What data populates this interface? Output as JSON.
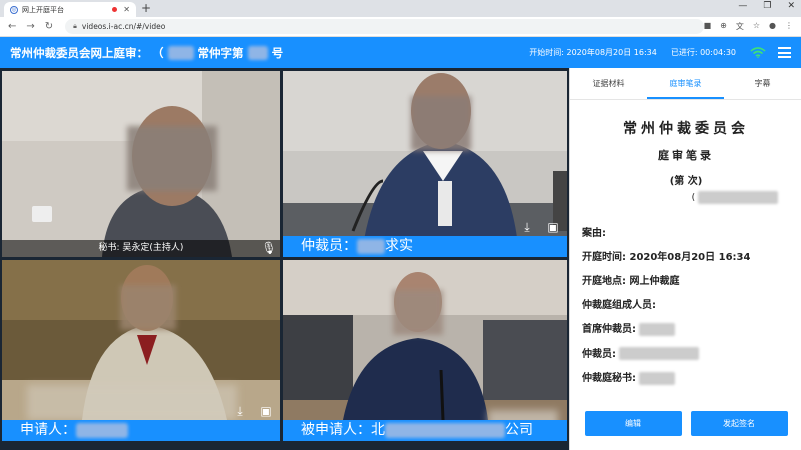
{
  "browser": {
    "tab_title": "网上开庭平台",
    "url": "videos.i-ac.cn/#/video"
  },
  "header": {
    "title_prefix": "常州仲裁委员会网上庭审：",
    "case_prefix": "（",
    "case_mid": "常仲字第",
    "case_suffix": "号",
    "start_label": "开始时间: 2020年08月20日 16:34",
    "elapsed_label": "已进行: 00:04:30"
  },
  "videos": {
    "secretary_caption": "秘书: 吴永定(主持人)",
    "arbitrator_caption_prefix": "仲裁员：",
    "arbitrator_caption_suffix": "求实",
    "applicant_caption_prefix": "申请人：",
    "respondent_caption_prefix": "被申请人：北",
    "respondent_caption_suffix": "公司"
  },
  "panel": {
    "tabs": [
      "证据材料",
      "庭审笔录",
      "字幕"
    ],
    "active_tab": 1,
    "doc_title": "常州仲裁委员会",
    "doc_subtitle": "庭审笔录",
    "doc_session": "(第  次)",
    "doc_number_prefix": "(",
    "rows": {
      "case": "案由:",
      "time": "开庭时间: 2020年08月20日 16:34",
      "place": "开庭地点: 网上仲裁庭",
      "tribunal": "仲裁庭组成人员:",
      "chief": "首席仲裁员:",
      "arbitrator": "仲裁员:",
      "secretary": "仲裁庭秘书:"
    },
    "edit_button": "编辑",
    "sign_button": "发起签名"
  },
  "colors": {
    "accent": "#1890ff",
    "wifi": "#3ee07a"
  }
}
